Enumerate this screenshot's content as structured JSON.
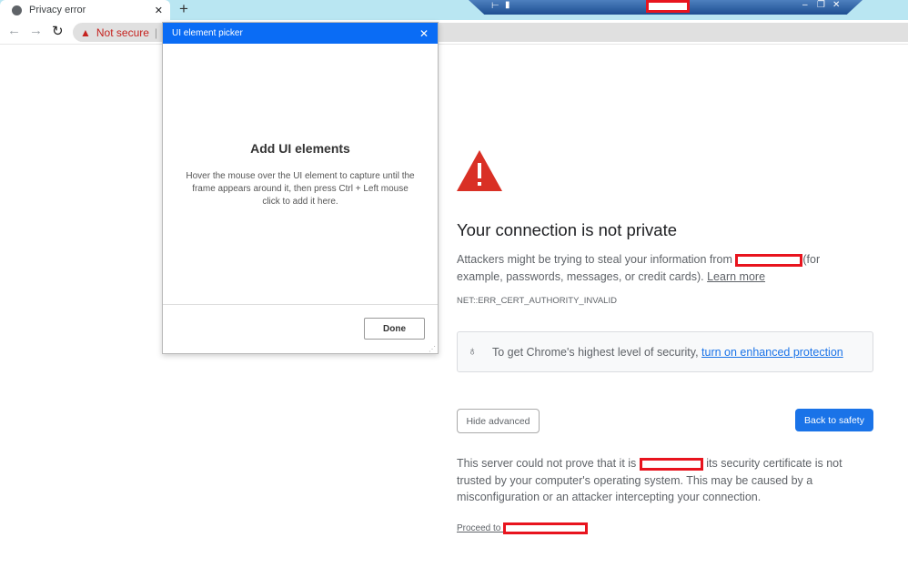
{
  "browser": {
    "tab_title": "Privacy error",
    "new_tab": "+",
    "close_tab": "✕",
    "security_label": "Not secure"
  },
  "picker": {
    "title": "UI element picker",
    "heading": "Add UI elements",
    "instructions": "Hover the mouse over the UI element to capture until the frame appears around it, then press Ctrl + Left mouse click to add it here.",
    "done": "Done"
  },
  "page": {
    "heading": "Your connection is not private",
    "p1_before": "Attackers might be trying to steal your information from ",
    "p1_after": "(for example, passwords, messages, or credit cards). ",
    "learn_more": "Learn more",
    "error_code": "NET::ERR_CERT_AUTHORITY_INVALID",
    "tip_before": "To get Chrome's highest level of security, ",
    "tip_link": "turn on enhanced protection",
    "hide_advanced": "Hide advanced",
    "back_to_safety": "Back to safety",
    "p2_before": "This server could not prove that it is ",
    "p2_after": " its security certificate is not trusted by your computer's operating system. This may be caused by a misconfiguration or an attacker intercepting your connection.",
    "proceed": "Proceed to "
  },
  "colors": {
    "accent": "#1a73e8",
    "warning": "#d93025",
    "picker_header": "#0a6cf5",
    "redaction": "#e8141e"
  }
}
